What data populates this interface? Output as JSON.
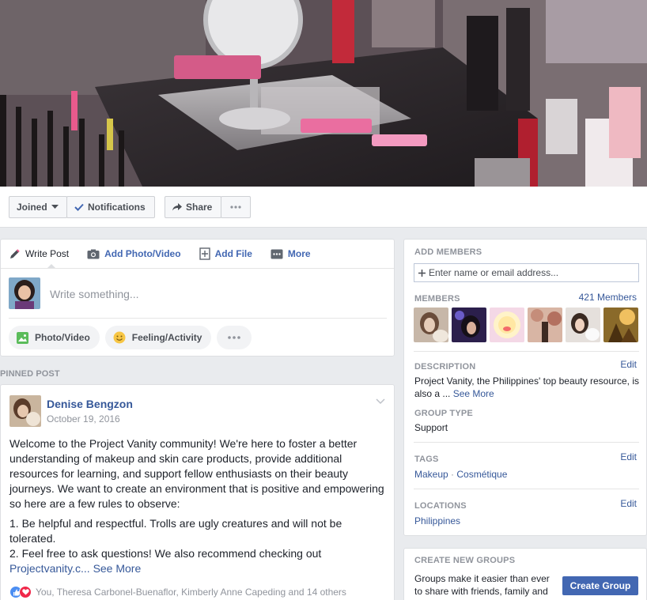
{
  "colors": {
    "accent": "#4267b2",
    "link": "#365899",
    "muted": "#90949c",
    "bg": "#e9ebee"
  },
  "toolbar": {
    "joined_label": "Joined",
    "notifications_label": "Notifications",
    "share_label": "Share"
  },
  "composer": {
    "tabs": [
      {
        "label": "Write Post",
        "icon": "pencil-icon"
      },
      {
        "label": "Add Photo/Video",
        "icon": "camera-icon"
      },
      {
        "label": "Add File",
        "icon": "file-plus-icon"
      },
      {
        "label": "More",
        "icon": "more-icon"
      }
    ],
    "placeholder": "Write something...",
    "pills": [
      {
        "label": "Photo/Video",
        "icon": "photo-icon"
      },
      {
        "label": "Feeling/Activity",
        "icon": "smiley-icon"
      }
    ]
  },
  "pinned": {
    "label": "PINNED POST",
    "author": "Denise Bengzon",
    "date": "October 19, 2016",
    "paragraph1": "Welcome to the Project Vanity community! We're here to foster a better understanding of makeup and skin care products, provide additional resources for learning, and support fellow enthusiasts on their beauty journeys. We want to create an environment that is positive and empowering so here are a few rules to observe:",
    "rule1": "1. Be helpful and respectful. Trolls are ugly creatures and will not be tolerated.",
    "rule2": "2. Feel free to ask questions! We also recommend checking out",
    "link_text": "Projectvanity.c...",
    "see_more": "See More",
    "reactions_text": "You, Theresa Carbonel-Buenaflor, Kimberly Anne Capeding and 14 others"
  },
  "sidebar": {
    "add_members_title": "ADD MEMBERS",
    "add_members_placeholder": "Enter name or email address...",
    "members_title": "MEMBERS",
    "members_count": "421 Members",
    "description_title": "DESCRIPTION",
    "edit_label": "Edit",
    "description_text": "Project Vanity, the Philippines' top beauty resource, is also a ...",
    "see_more": "See More",
    "group_type_title": "GROUP TYPE",
    "group_type": "Support",
    "tags_title": "TAGS",
    "tag1": "Makeup",
    "tag_sep": " · ",
    "tag2": "Cosmétique",
    "locations_title": "LOCATIONS",
    "location": "Philippines",
    "create_title": "CREATE NEW GROUPS",
    "create_text": "Groups make it easier than ever to share with friends, family and",
    "create_button": "Create Group"
  }
}
